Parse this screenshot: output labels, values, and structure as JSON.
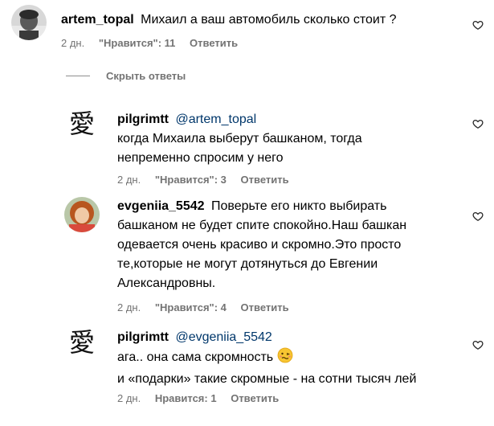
{
  "comments": [
    {
      "username": "artem_topal",
      "mention": "",
      "lines": [
        "Михаил а ваш автомобиль сколько стоит ?"
      ],
      "time": "2 дн.",
      "likes": "\"Нравится\": 11",
      "reply": "Ответить",
      "avatar": "photo-man"
    },
    {
      "username": "pilgrimtt",
      "mention": "@artem_topal",
      "lines": [
        "когда Михаила выберут башканом, тогда",
        "непременно спросим у него"
      ],
      "time": "2 дн.",
      "likes": "\"Нравится\": 3",
      "reply": "Ответить",
      "avatar": "kanji-ai"
    },
    {
      "username": "evgeniia_5542",
      "mention": "",
      "lines": [
        "Поверьте его никто выбирать",
        "башканом не будет спите спокойно.Наш башкан",
        "одевается очень красиво и скромно.Это просто",
        "те,которые не могут дотянуться до Евгении",
        "Александровны."
      ],
      "time": "2 дн.",
      "likes": "\"Нравится\": 4",
      "reply": "Ответить",
      "avatar": "photo-woman"
    },
    {
      "username": "pilgrimtt",
      "mention": "@evgeniia_5542",
      "lines": [
        "ага.. она сама скромность",
        "и «подарки» такие скромные - на сотни тысяч лей"
      ],
      "time": "2 дн.",
      "likes": "Нравится: 1",
      "reply": "Ответить",
      "avatar": "kanji-ai"
    }
  ],
  "hide_replies": "Скрыть ответы",
  "icons": {
    "like": "heart-icon",
    "emoji": "woozy-face-emoji"
  },
  "colors": {
    "meta": "#737373",
    "mention": "#00376b",
    "text": "#000000"
  }
}
